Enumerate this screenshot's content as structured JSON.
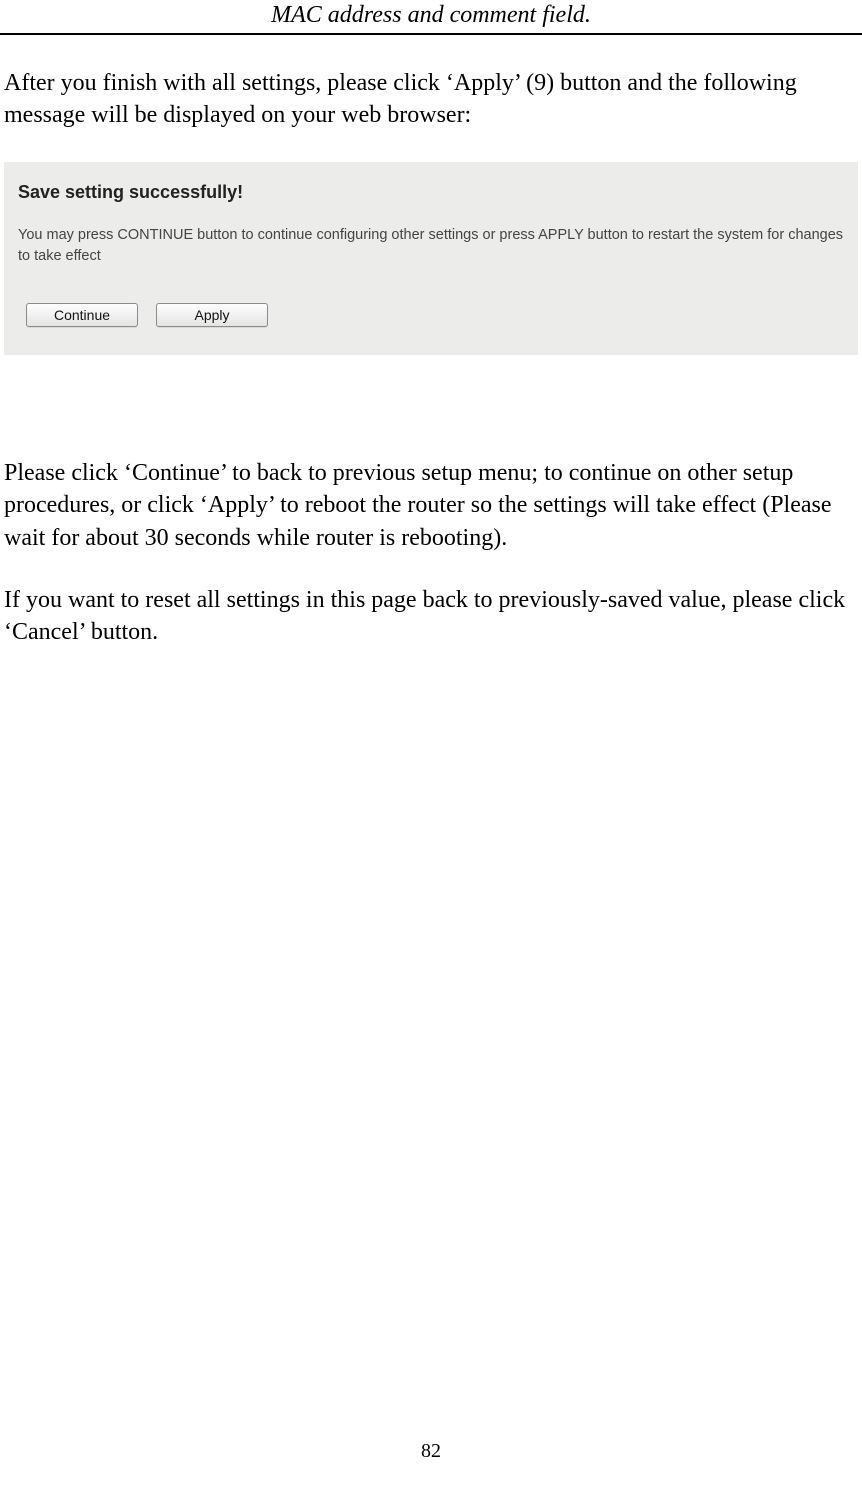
{
  "header": {
    "title": "MAC address and comment field."
  },
  "paragraphs": {
    "p1": "After you finish with all settings, please click ‘Apply’ (9) button and the following message will be displayed on your web browser:",
    "p2": "Please click ‘Continue’ to back to previous setup menu; to continue on other setup procedures, or click ‘Apply’ to reboot the router so the settings will take effect (Please wait for about 30 seconds while router is rebooting).",
    "p3": "If you want to reset all settings in this page back to previously-saved value, please click ‘Cancel’ button."
  },
  "screenshot": {
    "title": "Save setting successfully!",
    "description": "You may press CONTINUE button to continue configuring other settings or press APPLY button to restart the system for changes to take effect",
    "buttons": {
      "continue": "Continue",
      "apply": "Apply"
    }
  },
  "footer": {
    "page_number": "82"
  }
}
